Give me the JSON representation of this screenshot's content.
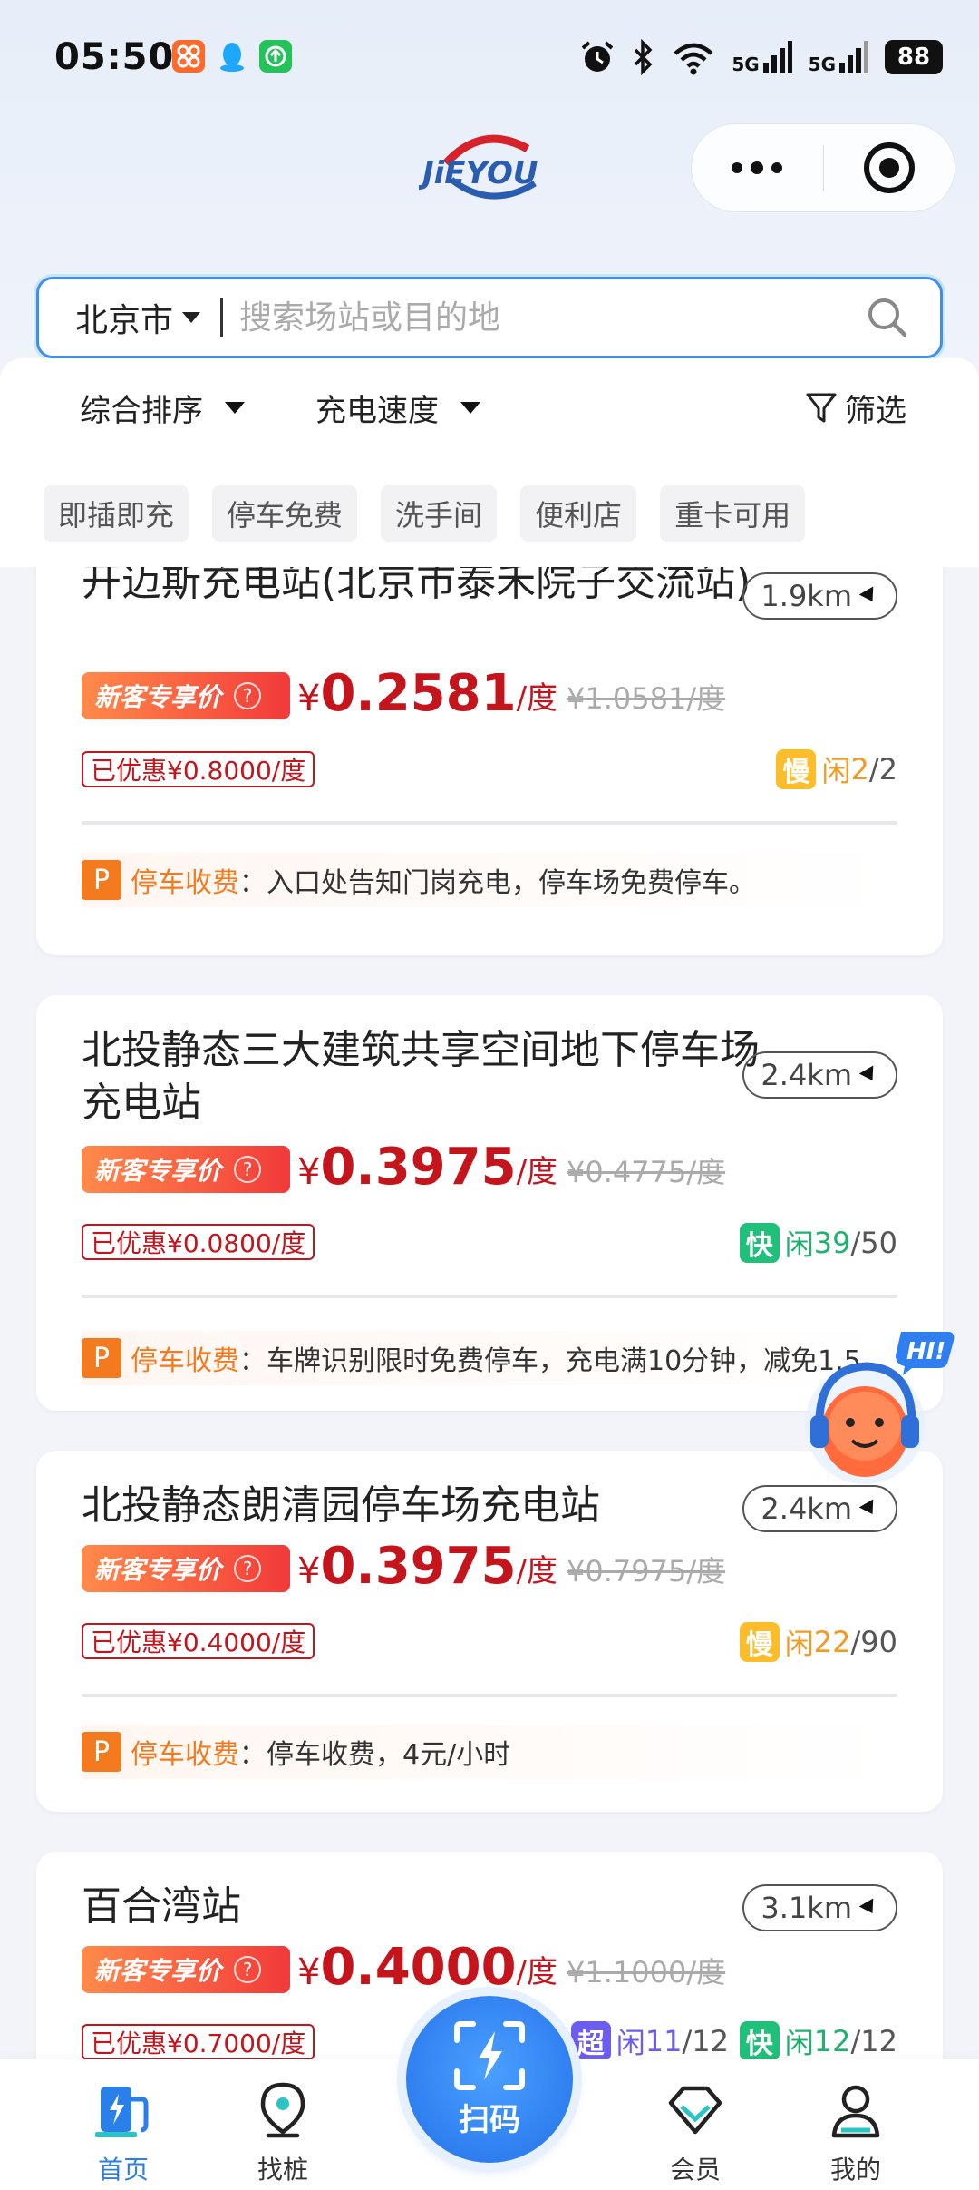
{
  "status_bar": {
    "time": "05:50",
    "network_1": "5G",
    "network_2": "5G",
    "battery": "88"
  },
  "header": {
    "logo_text": "JiEYOU"
  },
  "search": {
    "city": "北京市",
    "placeholder": "搜索场站或目的地"
  },
  "filters": {
    "sort_label": "综合排序",
    "speed_label": "充电速度",
    "filter_label": "筛选",
    "tags": [
      "即插即充",
      "停车免费",
      "洗手间",
      "便利店",
      "重卡可用"
    ]
  },
  "stations": [
    {
      "name": "开迈斯充电站(北京市泰禾院子交流站)",
      "distance": "1.9km",
      "badge": "新客专享价",
      "yen": "¥",
      "price": "0.2581",
      "unit": "/度",
      "orig_price": "¥1.0581/度",
      "discount": "已优惠¥0.8000/度",
      "speed": "慢",
      "speed_type": "slow",
      "free_label": "闲",
      "free": "2",
      "total": "/2",
      "parking_label": "停车收费",
      "parking_text": "：入口处告知门岗充电，停车场免费停车。"
    },
    {
      "name": "北投静态三大建筑共享空间地下停车场充电站",
      "distance": "2.4km",
      "badge": "新客专享价",
      "yen": "¥",
      "price": "0.3975",
      "unit": "/度",
      "orig_price": "¥0.4775/度",
      "discount": "已优惠¥0.0800/度",
      "speed": "快",
      "speed_type": "fast",
      "free_label": "闲",
      "free": "39",
      "total": "/50",
      "parking_label": "停车收费",
      "parking_text": "：车牌识别限时免费停车，充电满10分钟，减免1.5"
    },
    {
      "name": "北投静态朗清园停车场充电站",
      "distance": "2.4km",
      "badge": "新客专享价",
      "yen": "¥",
      "price": "0.3975",
      "unit": "/度",
      "orig_price": "¥0.7975/度",
      "discount": "已优惠¥0.4000/度",
      "speed": "慢",
      "speed_type": "slow",
      "free_label": "闲",
      "free": "22",
      "total": "/90",
      "parking_label": "停车收费",
      "parking_text": "：停车收费，4元/小时"
    },
    {
      "name": "百合湾站",
      "distance": "3.1km",
      "badge": "新客专享价",
      "yen": "¥",
      "price": "0.4000",
      "unit": "/度",
      "orig_price": "¥1.1000/度",
      "discount": "已优惠¥0.7000/度",
      "avail_1": {
        "speed": "超",
        "free_label": "闲",
        "free": "11",
        "total": "/12"
      },
      "avail_2": {
        "speed": "快",
        "free_label": "闲",
        "free": "12",
        "total": "/12"
      }
    }
  ],
  "assistant": {
    "bubble": "HI!"
  },
  "bottom_nav": {
    "home": "首页",
    "find": "找桩",
    "scan": "扫码",
    "member": "会员",
    "mine": "我的"
  },
  "colors": {
    "accent": "#2b7fe8",
    "price_red": "#c4141c",
    "parking_orange": "#f47a1f"
  }
}
